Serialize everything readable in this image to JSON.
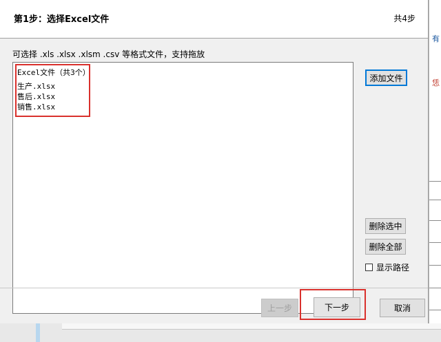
{
  "header": {
    "step_title": "第1步：选择Excel文件",
    "step_count": "共4步"
  },
  "hint": "可选择 .xls  .xlsx  .xlsm .csv 等格式文件，支持拖放",
  "file_list": {
    "heading": "Excel文件（共3个）",
    "files": [
      "生产.xlsx",
      "售后.xlsx",
      "销售.xlsx"
    ]
  },
  "side_buttons": {
    "add_file": "添加文件",
    "delete_selected": "删除选中",
    "delete_all": "删除全部",
    "show_path": "显示路径"
  },
  "footer": {
    "prev": "上一步",
    "next": "下一步",
    "cancel": "取消"
  },
  "background": {
    "side_marks": [
      "有",
      "恁"
    ]
  },
  "colors": {
    "annotation_red": "#d9302c",
    "focus_blue": "#0078d7"
  }
}
